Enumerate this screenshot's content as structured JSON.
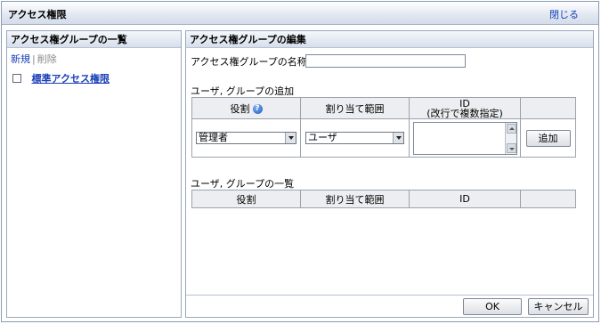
{
  "window": {
    "title": "アクセス権限",
    "close_label": "閉じる"
  },
  "left_pane": {
    "header": "アクセス権グループの一覧",
    "new_label": "新規",
    "separator": "|",
    "delete_label": "削除",
    "items": [
      {
        "label": "標準アクセス権限",
        "checked": false
      }
    ]
  },
  "right_pane": {
    "header": "アクセス権グループの編集",
    "name_label": "アクセス権グループの名称",
    "name_value": "",
    "add_section_label": "ユーザ, グループの追加",
    "add_table": {
      "col_role": "役割",
      "col_scope": "割り当て範囲",
      "col_id_line1": "ID",
      "col_id_line2": "(改行で複数指定)",
      "role_selected": "管理者",
      "scope_selected": "ユーザ",
      "id_value": "",
      "add_button": "追加"
    },
    "list_section_label": "ユーザ, グループの一覧",
    "list_table": {
      "col_role": "役割",
      "col_scope": "割り当て範囲",
      "col_id": "ID",
      "col_extra": ""
    },
    "ok_button": "OK",
    "cancel_button": "キャンセル"
  }
}
